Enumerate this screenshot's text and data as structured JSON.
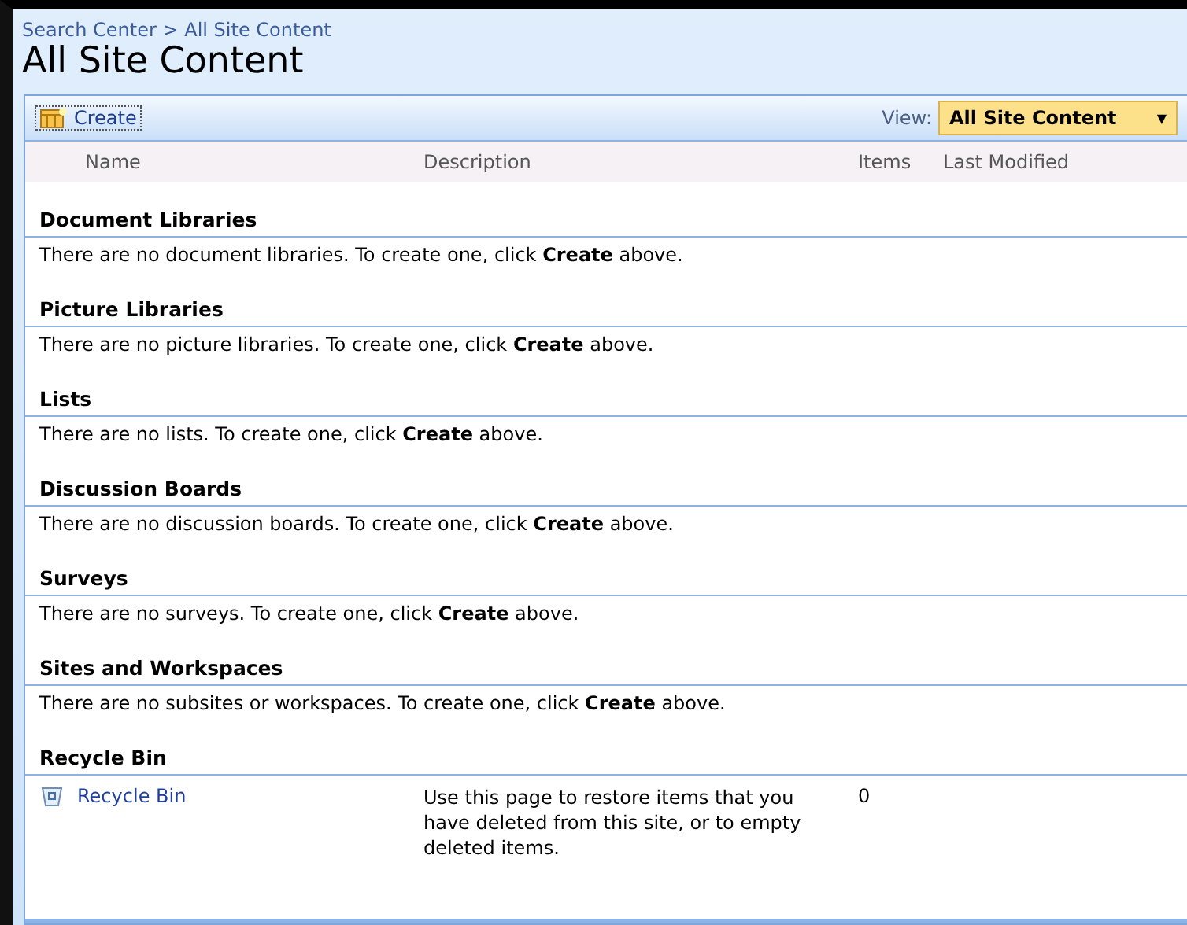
{
  "breadcrumb": "Search Center > All Site Content",
  "title": "All Site Content",
  "toolbar": {
    "create": "Create",
    "view_label": "View:",
    "view_value": "All Site Content",
    "view_caret": "▼"
  },
  "columns": [
    "Name",
    "Description",
    "Items",
    "Last Modified"
  ],
  "sections": [
    {
      "heading": "Document Libraries",
      "message": "There are no document libraries. To create one, click **Create** above."
    },
    {
      "heading": "Picture Libraries",
      "message": "There are no picture libraries. To create one, click **Create** above."
    },
    {
      "heading": "Lists",
      "message": "There are no lists. To create one, click **Create** above."
    },
    {
      "heading": "Discussion Boards",
      "message": "There are no discussion boards. To create one, click **Create** above."
    },
    {
      "heading": "Surveys",
      "message": "There are no surveys. To create one, click **Create** above."
    },
    {
      "heading": "Sites and Workspaces",
      "message": "There are no subsites or workspaces. To create one, click **Create** above."
    }
  ],
  "recycle_bin": {
    "heading": "Recycle Bin",
    "name": "Recycle Bin",
    "description": "Use this page to restore items that you have deleted from this site, or to empty deleted items.",
    "items": "0"
  }
}
